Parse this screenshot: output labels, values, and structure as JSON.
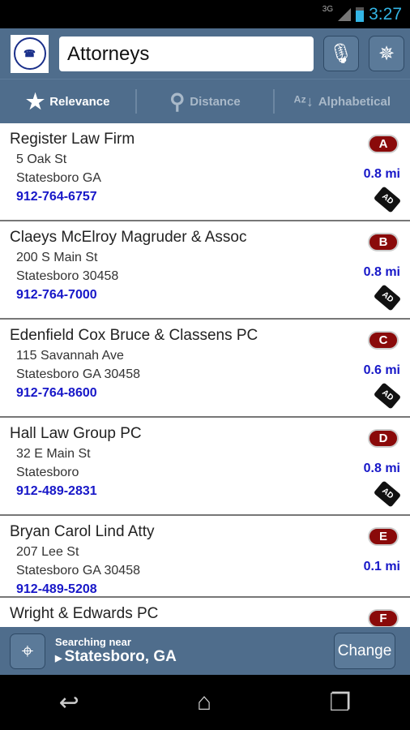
{
  "status": {
    "network": "3G",
    "time": "3:27"
  },
  "header": {
    "logo_text": "BULLOCH TELEPHONE COOPERATIVE",
    "search_value": "Attorneys",
    "mic_icon": "microphone-icon",
    "compass_icon": "compass-icon"
  },
  "sort": [
    {
      "label": "Relevance",
      "icon": "star-icon",
      "active": true
    },
    {
      "label": "Distance",
      "icon": "map-pins-icon"
    },
    {
      "label": "Alphabetical",
      "icon": "az-sort-icon"
    }
  ],
  "listings": [
    {
      "name": "Register Law Firm",
      "address": "5 Oak St",
      "city": "Statesboro GA",
      "phone": "912-764-6757",
      "badge": "A",
      "distance": "0.8 mi",
      "ad": "AD"
    },
    {
      "name": "Claeys McElroy Magruder & Assoc",
      "address": "200 S Main St",
      "city": "Statesboro 30458",
      "phone": "912-764-7000",
      "badge": "B",
      "distance": "0.8 mi",
      "ad": "AD"
    },
    {
      "name": "Edenfield Cox Bruce & Classens PC",
      "address": "115 Savannah Ave",
      "city": "Statesboro GA 30458",
      "phone": "912-764-8600",
      "badge": "C",
      "distance": "0.6 mi",
      "ad": "AD"
    },
    {
      "name": "Hall Law Group PC",
      "address": "32 E Main St",
      "city": "Statesboro",
      "phone": "912-489-2831",
      "badge": "D",
      "distance": "0.8 mi",
      "ad": "AD"
    },
    {
      "name": "Bryan Carol Lind Atty",
      "address": "207 Lee St",
      "city": "Statesboro GA 30458",
      "phone": "912-489-5208",
      "badge": "E",
      "distance": "0.1 mi"
    },
    {
      "name": "Wright & Edwards PC",
      "badge": "F"
    }
  ],
  "bottom": {
    "searching_label": "Searching near",
    "location": "Statesboro, GA",
    "change_label": "Change"
  },
  "colors": {
    "bar": "#4f6d8c",
    "badge": "#8a0a0a",
    "link": "#1717c8"
  }
}
